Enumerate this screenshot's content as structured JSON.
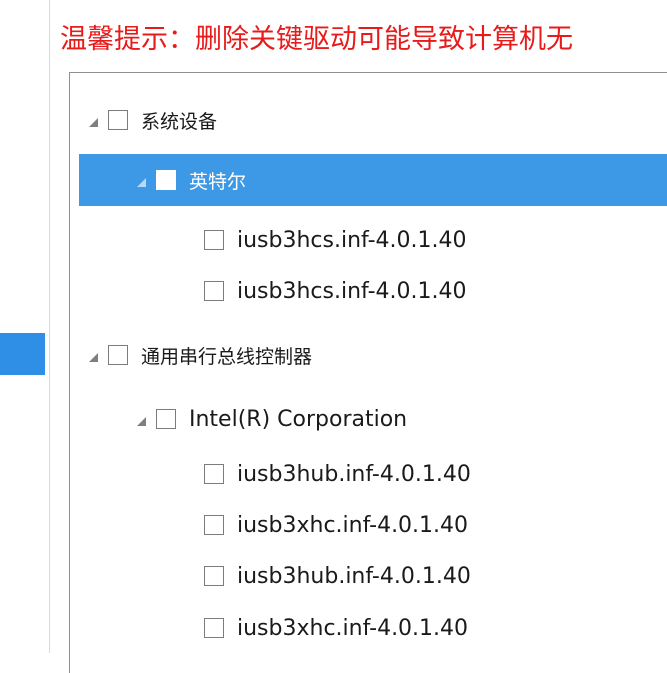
{
  "warning": "温馨提示：删除关键驱动可能导致计算机无",
  "tree": {
    "rows": [
      {
        "label": "系统设备"
      },
      {
        "label": "英特尔"
      },
      {
        "label": "iusb3hcs.inf-4.0.1.40"
      },
      {
        "label": "iusb3hcs.inf-4.0.1.40"
      },
      {
        "label": "通用串行总线控制器"
      },
      {
        "label": "Intel(R) Corporation"
      },
      {
        "label": "iusb3hub.inf-4.0.1.40"
      },
      {
        "label": "iusb3xhc.inf-4.0.1.40"
      },
      {
        "label": "iusb3hub.inf-4.0.1.40"
      },
      {
        "label": "iusb3xhc.inf-4.0.1.40"
      }
    ]
  },
  "colors": {
    "warning_text": "#e81b1b",
    "selection": "#3d99e6",
    "side_accent": "#2f8fe6"
  }
}
